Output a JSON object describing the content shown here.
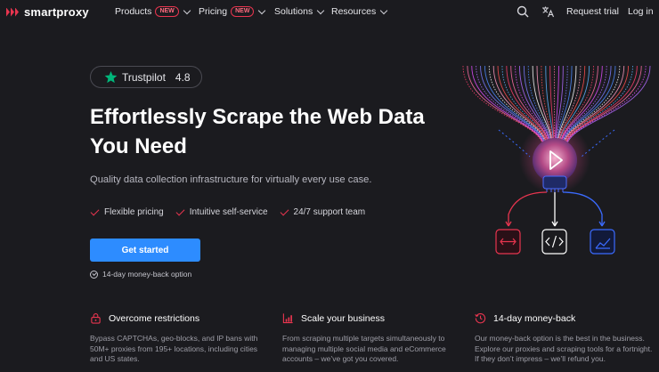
{
  "brand": {
    "name": "smartproxy",
    "accent": "#e8354f",
    "primary_button": "#2d8cff"
  },
  "nav": {
    "items": [
      {
        "label": "Products",
        "badge": "NEW"
      },
      {
        "label": "Pricing",
        "badge": "NEW"
      },
      {
        "label": "Solutions"
      },
      {
        "label": "Resources"
      }
    ],
    "search_icon": "search-icon",
    "language_icon": "translate-icon",
    "request_trial": "Request trial",
    "login": "Log in"
  },
  "hero": {
    "trustpilot": {
      "label": "Trustpilot",
      "rating": "4.8"
    },
    "title": "Effortlessly Scrape the Web Data You Need",
    "subtitle": "Quality data collection infrastructure for virtually every use case.",
    "features": [
      "Flexible pricing",
      "Intuitive self-service",
      "24/7 support team"
    ],
    "cta": "Get started",
    "guarantee": "14-day money-back option"
  },
  "benefits": [
    {
      "title": "Overcome restrictions",
      "icon": "lock-icon",
      "text": "Bypass CAPTCHAs, geo-blocks, and IP bans with 50M+ proxies from 195+ locations, including cities and US states."
    },
    {
      "title": "Scale your business",
      "icon": "chart-icon",
      "text": "From scraping multiple targets simultaneously to managing multiple social media and eCommerce accounts – we’ve got you covered."
    },
    {
      "title": "14-day money-back",
      "icon": "money-back-icon",
      "text": "Our money-back option is the best in the business. Explore our proxies and scraping tools for a fortnight. If they don’t impress – we’ll refund you."
    }
  ],
  "graphic": {
    "center_icon": "play-icon",
    "output_icons": [
      "transfer-icon",
      "code-icon",
      "chart-line-icon"
    ]
  }
}
